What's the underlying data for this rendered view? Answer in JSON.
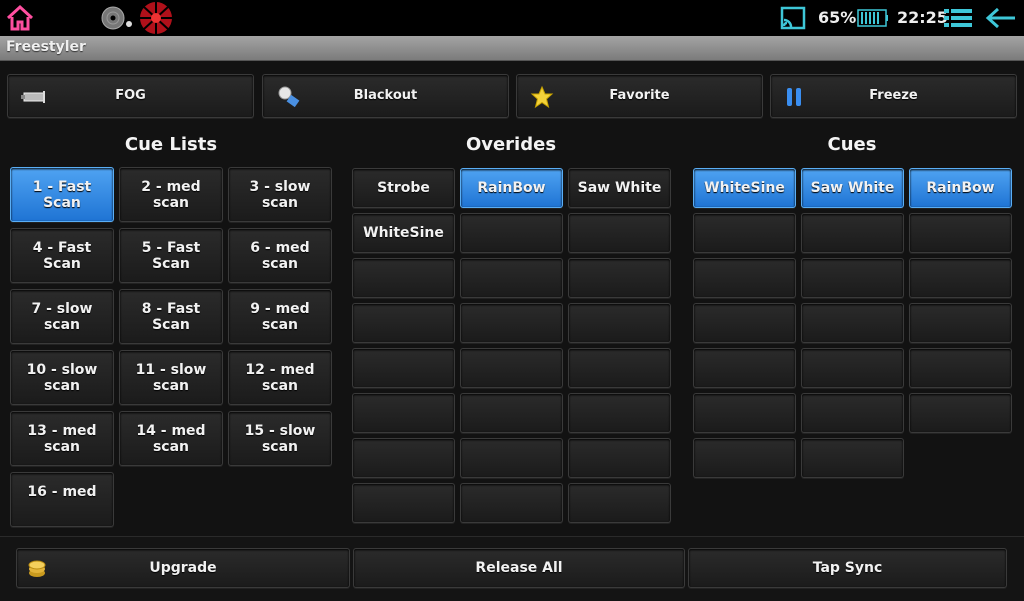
{
  "status_bar": {
    "battery_percent": "65%",
    "time": "22:25",
    "accent_color": "#3ec7d8",
    "icons": [
      "home-icon",
      "disc-icon",
      "burst-icon",
      "cast-icon",
      "battery-icon",
      "menu-icon",
      "back-arrow-icon"
    ]
  },
  "app": {
    "title": "Freestyler"
  },
  "toolbar": {
    "fog_label": "FOG",
    "blackout_label": "Blackout",
    "favorite_label": "Favorite",
    "freeze_label": "Freeze"
  },
  "sections": {
    "cue_lists_title": "Cue Lists",
    "overrides_title": "Overides",
    "cues_title": "Cues"
  },
  "cue_lists": [
    {
      "line1": "1 - Fast",
      "line2": "Scan",
      "active": true
    },
    {
      "line1": "2 - med",
      "line2": "scan",
      "active": false
    },
    {
      "line1": "3 - slow",
      "line2": "scan",
      "active": false
    },
    {
      "line1": "4 - Fast",
      "line2": "Scan",
      "active": false
    },
    {
      "line1": "5 - Fast",
      "line2": "Scan",
      "active": false
    },
    {
      "line1": "6 - med",
      "line2": "scan",
      "active": false
    },
    {
      "line1": "7 - slow",
      "line2": "scan",
      "active": false
    },
    {
      "line1": "8 - Fast",
      "line2": "Scan",
      "active": false
    },
    {
      "line1": "9 - med",
      "line2": "scan",
      "active": false
    },
    {
      "line1": "10 - slow",
      "line2": "scan",
      "active": false
    },
    {
      "line1": "11 - slow",
      "line2": "scan",
      "active": false
    },
    {
      "line1": "12 - med",
      "line2": "scan",
      "active": false
    },
    {
      "line1": "13 - med",
      "line2": "scan",
      "active": false
    },
    {
      "line1": "14 - med",
      "line2": "scan",
      "active": false
    },
    {
      "line1": "15 - slow",
      "line2": "scan",
      "active": false
    },
    {
      "line1": "16 - med",
      "line2": "",
      "active": false
    }
  ],
  "overrides": [
    {
      "label": "Strobe",
      "active": false
    },
    {
      "label": "RainBow",
      "active": true
    },
    {
      "label": "Saw White",
      "active": false
    },
    {
      "label": "WhiteSine",
      "active": false
    },
    {
      "label": "",
      "active": false
    },
    {
      "label": "",
      "active": false
    },
    {
      "label": "",
      "active": false
    },
    {
      "label": "",
      "active": false
    },
    {
      "label": "",
      "active": false
    },
    {
      "label": "",
      "active": false
    },
    {
      "label": "",
      "active": false
    },
    {
      "label": "",
      "active": false
    },
    {
      "label": "",
      "active": false
    },
    {
      "label": "",
      "active": false
    },
    {
      "label": "",
      "active": false
    },
    {
      "label": "",
      "active": false
    },
    {
      "label": "",
      "active": false
    },
    {
      "label": "",
      "active": false
    },
    {
      "label": "",
      "active": false
    },
    {
      "label": "",
      "active": false
    },
    {
      "label": "",
      "active": false
    },
    {
      "label": "",
      "active": false
    },
    {
      "label": "",
      "active": false
    },
    {
      "label": "",
      "active": false
    }
  ],
  "cues": [
    {
      "label": "WhiteSine",
      "active": true
    },
    {
      "label": "Saw White",
      "active": true
    },
    {
      "label": "RainBow",
      "active": true
    },
    {
      "label": "",
      "active": false
    },
    {
      "label": "",
      "active": false
    },
    {
      "label": "",
      "active": false
    },
    {
      "label": "",
      "active": false
    },
    {
      "label": "",
      "active": false
    },
    {
      "label": "",
      "active": false
    },
    {
      "label": "",
      "active": false
    },
    {
      "label": "",
      "active": false
    },
    {
      "label": "",
      "active": false
    },
    {
      "label": "",
      "active": false
    },
    {
      "label": "",
      "active": false
    },
    {
      "label": "",
      "active": false
    },
    {
      "label": "",
      "active": false
    },
    {
      "label": "",
      "active": false
    },
    {
      "label": "",
      "active": false
    },
    {
      "label": "",
      "active": false
    },
    {
      "label": "",
      "active": false
    }
  ],
  "bottom": {
    "upgrade_label": "Upgrade",
    "release_all_label": "Release All",
    "tap_sync_label": "Tap Sync"
  }
}
